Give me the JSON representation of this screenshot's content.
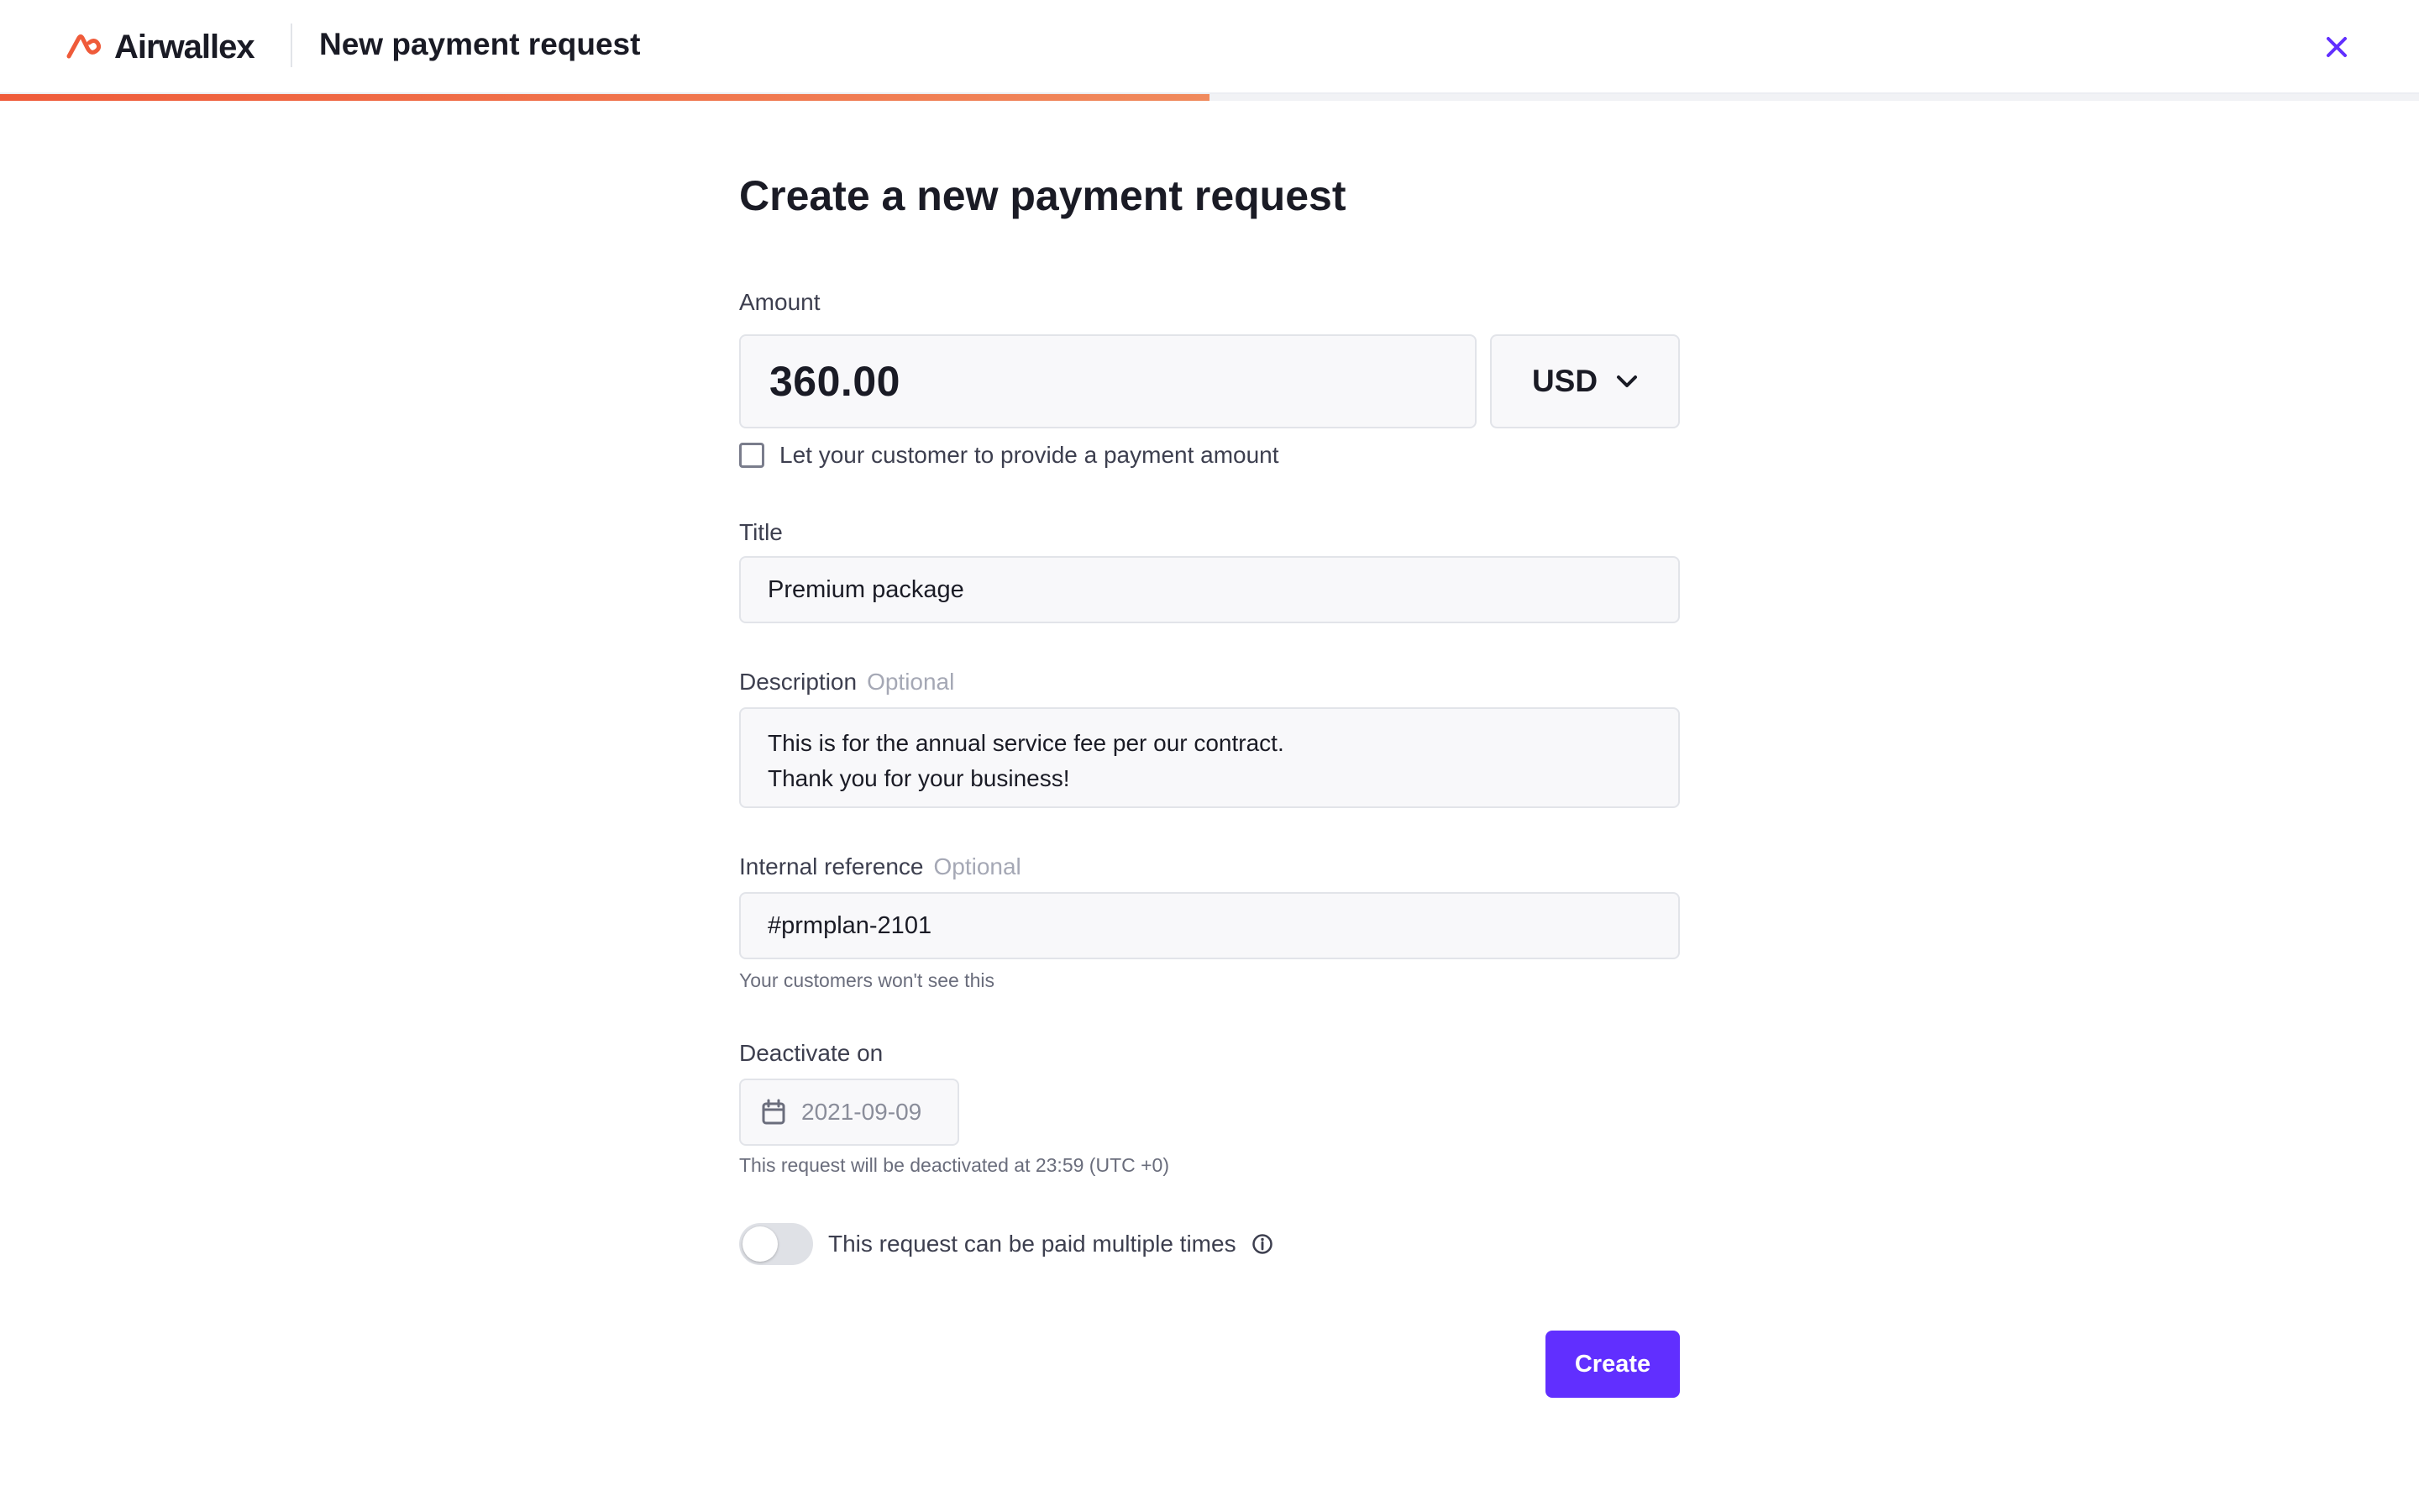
{
  "header": {
    "logo_text": "Airwallex",
    "title": "New payment request",
    "close_icon": "close-icon",
    "progress_fraction": 0.5
  },
  "form": {
    "heading": "Create a new payment request",
    "amount": {
      "label": "Amount",
      "value": "360.00",
      "currency": "USD",
      "currency_icon": "chevron-down-icon",
      "custom_amount_label": "Let your customer to provide a payment amount",
      "custom_amount_checked": false
    },
    "title": {
      "label": "Title",
      "value": "Premium package"
    },
    "description": {
      "label": "Description",
      "optional": "Optional",
      "lines": [
        "This is for the annual service fee per our contract.",
        "Thank you for your business!"
      ]
    },
    "internal_reference": {
      "label": "Internal reference",
      "optional": "Optional",
      "value": "#prmplan-2101",
      "hint": "Your customers won't see this"
    },
    "deactivate": {
      "label": "Deactivate on",
      "date": "2021-09-09",
      "icon": "calendar-icon",
      "hint": "This request will be deactivated at 23:59 (UTC +0)"
    },
    "multiple_payments": {
      "label": "This request can be paid multiple times",
      "enabled": false,
      "info_icon": "info-icon"
    },
    "submit_label": "Create"
  },
  "colors": {
    "brand_orange": "#ef5b3a",
    "primary_button": "#612fff",
    "close_icon": "#612fff"
  }
}
